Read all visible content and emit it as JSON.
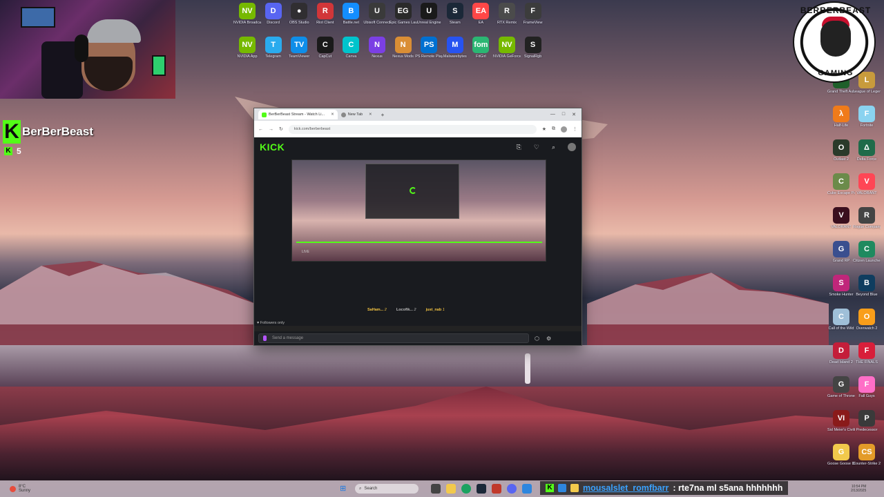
{
  "webcam": {
    "label": "Streamer webcam"
  },
  "kick_overlay": {
    "channel_name": "BerBerBeast",
    "logo_letter": "K",
    "viewer_count": "5"
  },
  "desktop_icons_top": [
    {
      "label": "NVIDIA Broadcast",
      "short": "NV",
      "color": "#76b900"
    },
    {
      "label": "Discord",
      "short": "D",
      "color": "#5865f2"
    },
    {
      "label": "OBS Studio",
      "short": "●",
      "color": "#302e31"
    },
    {
      "label": "Riot Client",
      "short": "R",
      "color": "#d13639"
    },
    {
      "label": "Battle.net",
      "short": "B",
      "color": "#148eff"
    },
    {
      "label": "Ubisoft Connect",
      "short": "U",
      "color": "#3a3a3a"
    },
    {
      "label": "Epic Games Launcher",
      "short": "EG",
      "color": "#2a2a2a"
    },
    {
      "label": "Unreal Engine",
      "short": "U",
      "color": "#1a1a1a"
    },
    {
      "label": "Steam",
      "short": "S",
      "color": "#1b2838"
    },
    {
      "label": "EA",
      "short": "EA",
      "color": "#ff4747"
    },
    {
      "label": "RTX Remix",
      "short": "R",
      "color": "#4b4b4b"
    },
    {
      "label": "FrameView",
      "short": "F",
      "color": "#3c3c3c"
    }
  ],
  "desktop_icons_bottom": [
    {
      "label": "NVIDIA App",
      "short": "NV",
      "color": "#76b900"
    },
    {
      "label": "Telegram",
      "short": "T",
      "color": "#2aabee"
    },
    {
      "label": "TeamViewer",
      "short": "TV",
      "color": "#0e8ee9"
    },
    {
      "label": "CapCut",
      "short": "C",
      "color": "#1a1a1a"
    },
    {
      "label": "Canva",
      "short": "C",
      "color": "#00c4cc"
    },
    {
      "label": "Nexus",
      "short": "N",
      "color": "#7b3fe4"
    },
    {
      "label": "Nexus Mods",
      "short": "N",
      "color": "#da8e35"
    },
    {
      "label": "PS Remote Play",
      "short": "PS",
      "color": "#0070d1"
    },
    {
      "label": "Malwarebytes",
      "short": "M",
      "color": "#2753f0"
    },
    {
      "label": "FitGirl",
      "short": "fom",
      "color": "#2bb673"
    },
    {
      "label": "NVIDIA GeForce",
      "short": "NV",
      "color": "#76b900"
    },
    {
      "label": "SignalRgb",
      "short": "S",
      "color": "#222"
    }
  ],
  "desktop_icons_right": [
    {
      "label": "Grand Theft Auto V",
      "short": "V",
      "color": "#1f5f2a"
    },
    {
      "label": "League of Legends",
      "short": "L",
      "color": "#c89b3c"
    },
    {
      "label": "Half-Life",
      "short": "λ",
      "color": "#f07b1a"
    },
    {
      "label": "Fortnite",
      "short": "F",
      "color": "#8ad3f0"
    },
    {
      "label": "Outlast 2",
      "short": "O",
      "color": "#2a3a2a"
    },
    {
      "label": "Delta Force",
      "short": "Δ",
      "color": "#1f6b4a"
    },
    {
      "label": "Cube Escape Paradox",
      "short": "C",
      "color": "#6b8b4a"
    },
    {
      "label": "VALORANT",
      "short": "V",
      "color": "#ff4655"
    },
    {
      "label": "VALORANT",
      "short": "V",
      "color": "#3a0f1e"
    },
    {
      "label": "Rogue Company",
      "short": "R",
      "color": "#444"
    },
    {
      "label": "Grand RP",
      "short": "G",
      "color": "#3a4f8f"
    },
    {
      "label": "Citizen Launcher",
      "short": "C",
      "color": "#1f8a5f"
    },
    {
      "label": "Smoke Hunter",
      "short": "S",
      "color": "#c0267a"
    },
    {
      "label": "Beyond Blue",
      "short": "B",
      "color": "#0f3d5f"
    },
    {
      "label": "Call of the Wild",
      "short": "C",
      "color": "#9fbfd8"
    },
    {
      "label": "Overwatch 2",
      "short": "O",
      "color": "#f99e1a"
    },
    {
      "label": "Dead Island 2",
      "short": "D",
      "color": "#c41e3a"
    },
    {
      "label": "THE FINALS",
      "short": "F",
      "color": "#d81e3a"
    },
    {
      "label": "Game of Thrones",
      "short": "G",
      "color": "#444"
    },
    {
      "label": "Fall Guys",
      "short": "F",
      "color": "#ff6ec7"
    },
    {
      "label": "Sid Meier's Civilization VI",
      "short": "VI",
      "color": "#8a1a1a"
    },
    {
      "label": "Predecessor",
      "short": "P",
      "color": "#3a3a3a"
    },
    {
      "label": "Goose Goose Duck",
      "short": "G",
      "color": "#f2c94c"
    },
    {
      "label": "Counter-Strike 2",
      "short": "CS",
      "color": "#e39b29"
    }
  ],
  "beast_logo": {
    "top_text": "BERBERBEAST",
    "bottom_text": "GAMING"
  },
  "browser": {
    "tabs": [
      {
        "label": "BerBerBeast Stream - Watch Li...",
        "active": true,
        "color": "#53fc18"
      },
      {
        "label": "New Tab",
        "active": false,
        "color": "#888"
      }
    ],
    "url": "kick.com/berberbeast",
    "window_controls": [
      "—",
      "□",
      "✕"
    ],
    "nav": [
      "←",
      "→",
      "↻"
    ],
    "toolbar_icons": [
      "★",
      "⧉",
      "⋮"
    ]
  },
  "kick": {
    "wordmark": "KICK",
    "header_icons": [
      "⎘",
      "♡",
      "⌕"
    ],
    "player_time": "LIVE",
    "chat_users": [
      {
        "name": "SaHam...",
        "count": "2"
      },
      {
        "name": "Locofik...",
        "count": "2"
      },
      {
        "name": "just_nab",
        "count": "1"
      }
    ],
    "followers_only": "Followers only",
    "chat_placeholder": "Send a message",
    "chat_tools": [
      "⬡",
      "⚙"
    ]
  },
  "taskbar": {
    "weather_temp": "8°C",
    "weather_desc": "Sunny",
    "search_placeholder": "Search",
    "start_icon": "⊞"
  },
  "chat_overlay": {
    "username": "mousalslet_romfbarr",
    "message": ": rte7na ml s5ana hhhhhhh"
  },
  "tray": {
    "time": "10:54 PM",
    "date": "2/13/2025"
  }
}
